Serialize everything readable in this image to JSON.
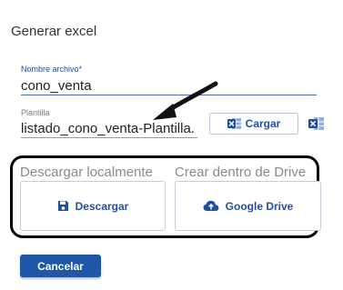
{
  "dialog": {
    "title": "Generar excel"
  },
  "form": {
    "name_field": {
      "label": "Nombre archivo",
      "required_mark": "*",
      "value": "cono_venta"
    },
    "template_field": {
      "label": "Plantilla",
      "value": "listado_cono_venta-Plantilla."
    },
    "load_button_label": "Cargar"
  },
  "export": {
    "local_section_label": "Descargar localmente",
    "drive_section_label": "Crear dentro de Drive",
    "download_button_label": "Descargar",
    "drive_button_label": "Google Drive"
  },
  "footer": {
    "cancel_label": "Cancelar"
  },
  "icons": {
    "load": "excel-icon",
    "excel": "excel-icon",
    "download": "floppy-disk-icon",
    "drive": "cloud-upload-icon",
    "annotation": "arrow-icon"
  },
  "colors": {
    "accent": "#1f4fa3",
    "primary_button": "#1f56a6",
    "excel_green": "#1f4fa3",
    "highlight_border": "#000000"
  }
}
